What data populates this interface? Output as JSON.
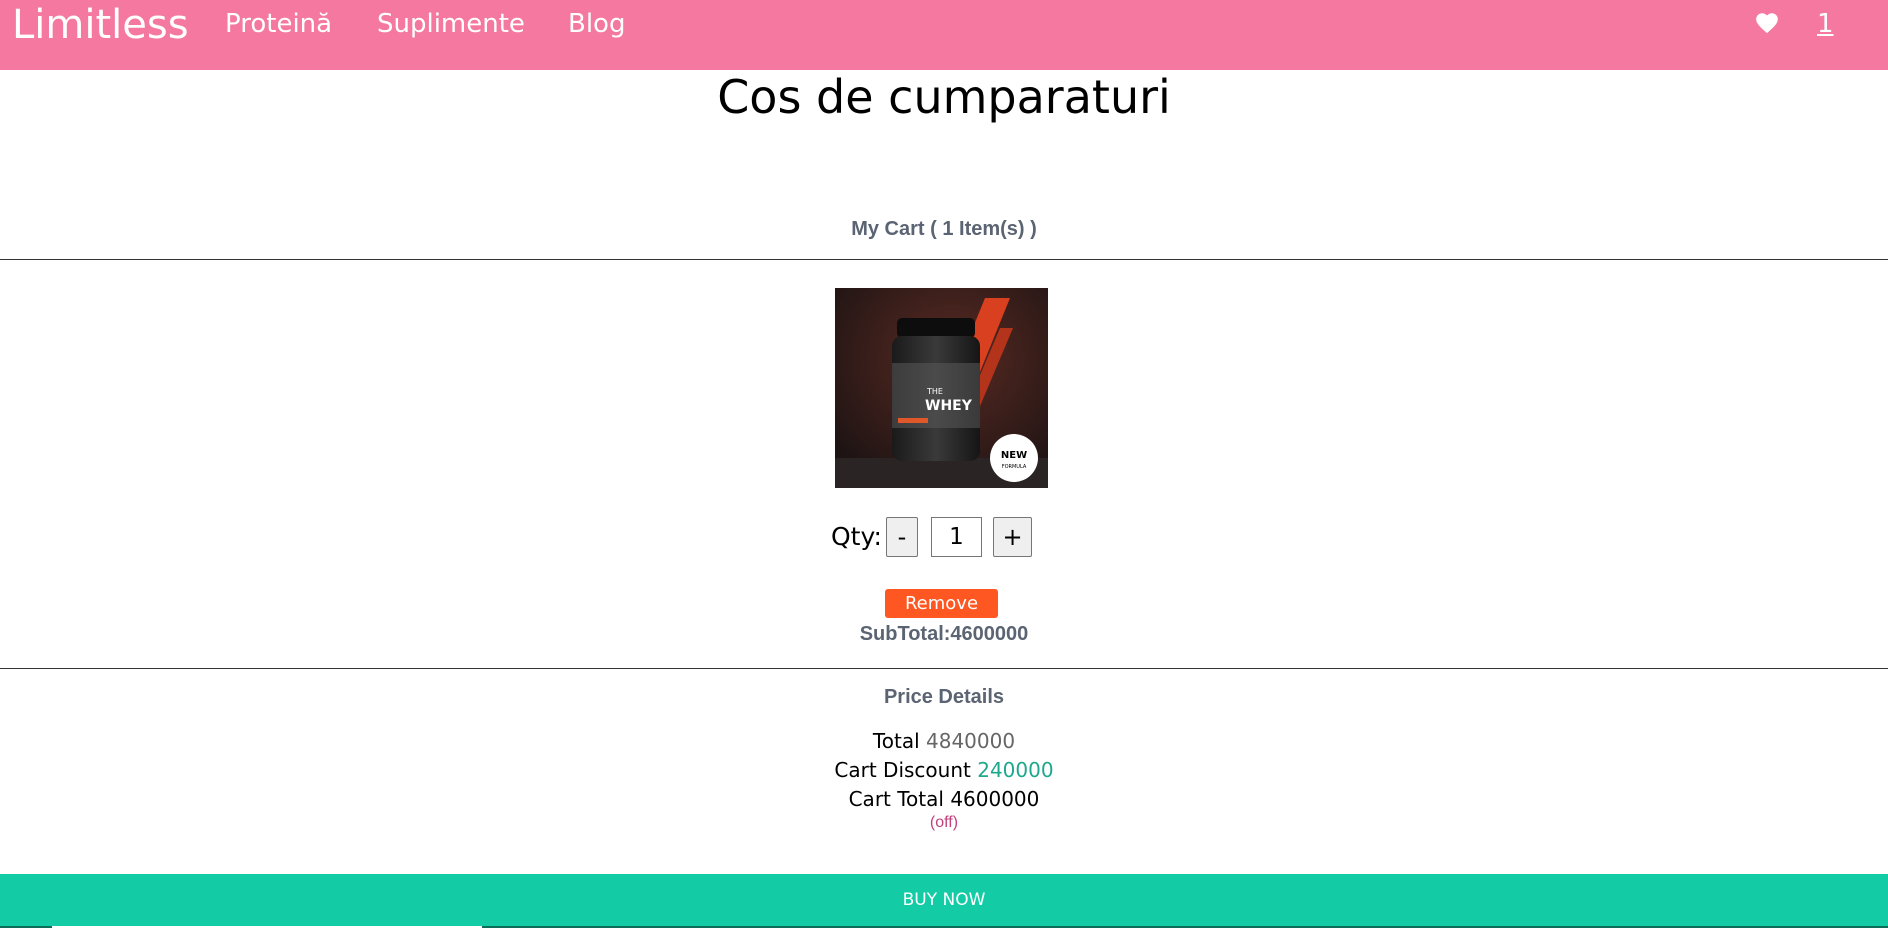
{
  "header": {
    "brand": "Limitless",
    "nav": [
      {
        "label": "Proteină"
      },
      {
        "label": "Suplimente"
      },
      {
        "label": "Blog"
      }
    ],
    "wishlist_icon": "heart-icon",
    "cart_count": "1"
  },
  "page": {
    "title": "Cos de cumparaturi"
  },
  "cart": {
    "heading": "My Cart ( 1 Item(s) )",
    "item": {
      "image_alt": "product-image",
      "image_label_line1": "THE",
      "image_label_line2": "WHEY",
      "image_badge_line1": "NEW",
      "image_badge_line2": "FORMULA",
      "qty_label": "Qty:",
      "minus_label": "-",
      "plus_label": "+",
      "qty_value": "1",
      "remove_label": "Remove",
      "subtotal": "SubTotal:4600000"
    }
  },
  "price_details": {
    "heading": "Price Details",
    "total_label": "Total",
    "total_value": "4840000",
    "discount_label": "Cart Discount",
    "discount_value": "240000",
    "cart_total_label": "Cart Total",
    "cart_total_value": "4600000",
    "off_note": "(off)"
  },
  "checkout": {
    "buy_label": "BUY NOW"
  },
  "colors": {
    "navbar": "#f478a0",
    "buy_bar": "#13cca6",
    "remove": "#ff5722",
    "discount": "#1fa88c",
    "off_note": "#c2417d"
  }
}
